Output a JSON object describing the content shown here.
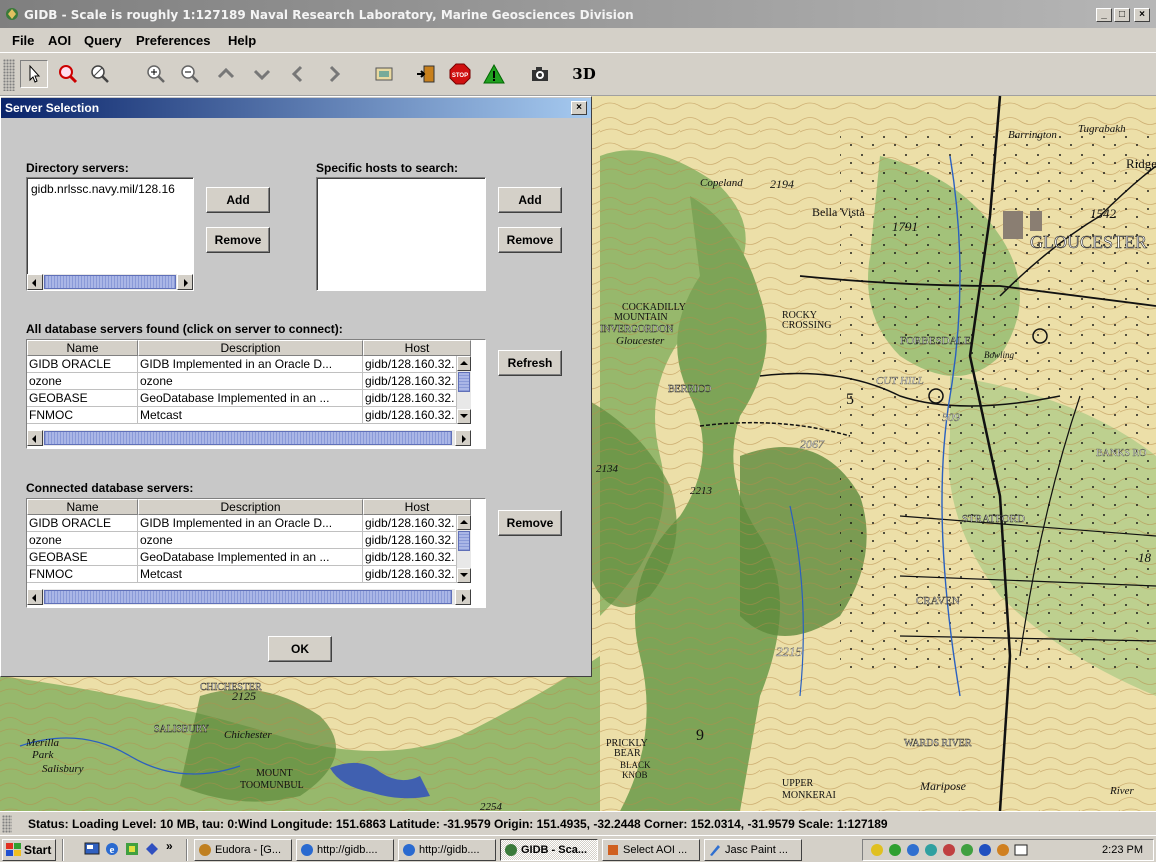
{
  "window": {
    "title": "GIDB - Scale is roughly 1:127189  Naval Research Laboratory, Marine Geosciences Division",
    "minimize": "_",
    "maximize": "□",
    "close": "×"
  },
  "menu": [
    "File",
    "AOI",
    "Query",
    "Preferences",
    "Help"
  ],
  "toolbar": {
    "tools": [
      "pointer-icon",
      "zoom-select-icon",
      "zoom-window-icon",
      "zoom-in-icon",
      "zoom-out-icon",
      "pan-up-icon",
      "pan-down-icon",
      "pan-left-icon",
      "pan-right-icon",
      "layers-icon",
      "export-icon",
      "stop-icon",
      "warning-icon",
      "camera-icon"
    ],
    "three_d_label": "3D"
  },
  "dialog": {
    "title": "Server Selection",
    "close": "×",
    "directory_label": "Directory servers:",
    "directory_items": [
      "gidb.nrlssc.navy.mil/128.16"
    ],
    "directory_add": "Add",
    "directory_remove": "Remove",
    "hosts_label": "Specific hosts to search:",
    "hosts_add": "Add",
    "hosts_remove": "Remove",
    "all_label": "All database servers found (click on server to connect):",
    "refresh": "Refresh",
    "columns": [
      "Name",
      "Description",
      "Host"
    ],
    "all_rows": [
      [
        "GIDB ORACLE",
        "GIDB Implemented in an Oracle D...",
        "gidb/128.160.32."
      ],
      [
        "ozone",
        "ozone",
        "gidb/128.160.32."
      ],
      [
        "GEOBASE",
        "GeoDatabase Implemented in an ...",
        "gidb/128.160.32."
      ],
      [
        "FNMOC",
        "Metcast",
        "gidb/128.160.32."
      ]
    ],
    "connected_label": "Connected database servers:",
    "connected_remove": "Remove",
    "connected_rows": [
      [
        "GIDB ORACLE",
        "GIDB Implemented in an Oracle D...",
        "gidb/128.160.32."
      ],
      [
        "ozone",
        "ozone",
        "gidb/128.160.32."
      ],
      [
        "GEOBASE",
        "GeoDatabase Implemented in an ...",
        "gidb/128.160.32."
      ],
      [
        "FNMOC",
        "Metcast",
        "gidb/128.160.32."
      ]
    ],
    "ok": "OK"
  },
  "map": {
    "labels": [
      "Barrington",
      "Tugrabakh",
      "Ridge",
      "Copeland",
      "Bella Vista",
      "1791",
      "1542",
      "GLOUCESTER",
      "COCKADILLY",
      "MOUNTAIN",
      "INVERGORDON",
      "Gloucester",
      "ROCKY",
      "CROSSING",
      "FORBESDALE",
      "Bowling",
      "BERRICO",
      "CUT HILL",
      "509",
      "2067",
      "BANKS RO",
      "STRATFORD",
      "CRAVEN",
      "2215",
      "CHICHESTER",
      "SALISBURY",
      "Merilla",
      "Park",
      "Salisbury",
      "Chichester",
      "MOUNT",
      "TOOMUNBUL",
      "PRICKLY",
      "BEAR",
      "WARDS RIVER",
      "UPPER",
      "MONKERAI",
      "Maripose",
      "River",
      "2125",
      "2254",
      "2213",
      "2134",
      "2194",
      "BLACK",
      "KNOB",
      "5",
      "9",
      "18"
    ]
  },
  "status": "Status: Loading Level: 10 MB, tau: 0:Wind  Longitude: 151.6863  Latitude: -31.9579  Origin: 151.4935, -32.2448  Corner: 152.0314, -31.9579  Scale: 1:127189",
  "taskbar": {
    "start": "Start",
    "more": "»",
    "tasks": [
      "Eudora - [G...",
      "http://gidb....",
      "http://gidb....",
      "GIDB - Sca...",
      "Select AOI ...",
      "Jasc Paint ..."
    ],
    "clock": "2:23 PM"
  }
}
